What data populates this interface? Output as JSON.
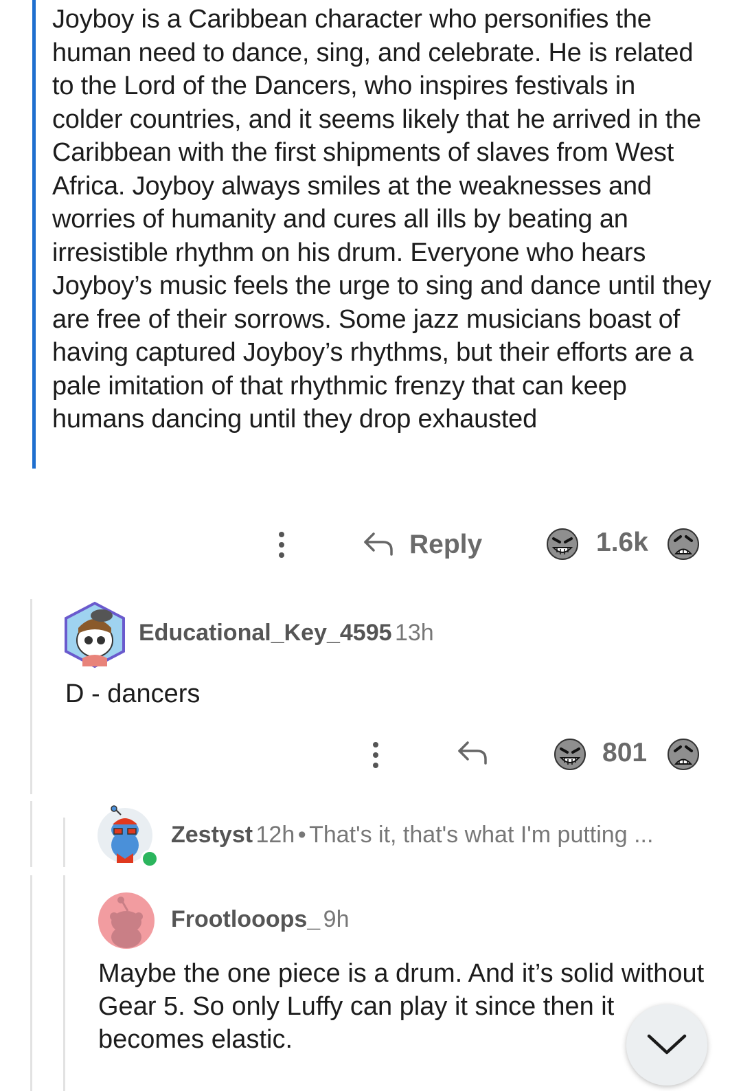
{
  "quote": {
    "text": "Joyboy is a Caribbean character who personifies the human need to dance, sing, and celebrate. He is related to the Lord of the Dancers, who inspires festivals in colder countries, and it seems likely that he arrived in the Caribbean with the first shipments of slaves from West Africa. Joyboy always smiles at the weaknesses and worries of humanity and cures all ills by beating an irresistible rhythm on his drum. Everyone who hears Joyboy’s music feels the urge to sing and dance until they are free of their sorrows. Some jazz musicians boast of having captured Joyboy’s rhythms, but their efforts are a pale imitation of that rhythmic frenzy that can keep humans dancing until they drop exhausted",
    "bar_color": "#1f6fcf"
  },
  "post_actions": {
    "reply_label": "Reply",
    "score": "1.6k"
  },
  "comments": [
    {
      "username": "Educational_Key_4595",
      "time": "13h",
      "text": "D - dancers",
      "score": "801"
    },
    {
      "username": "Zestyst",
      "time": "12h",
      "separator": "•",
      "preview": "That's it, that's what I'm putting ...",
      "online_color": "#2bb55d"
    },
    {
      "username": "Frootlooops_",
      "time": "9h",
      "text": "Maybe the one piece is a drum. And it’s solid without Gear 5. So only Luffy can play it since then it becomes elastic."
    }
  ],
  "icons": {
    "more": "more-vertical-icon",
    "reply": "reply-arrow-icon",
    "upvote": "upvote-face-icon",
    "downvote": "downvote-face-icon",
    "scroll_down": "chevron-down-icon"
  }
}
